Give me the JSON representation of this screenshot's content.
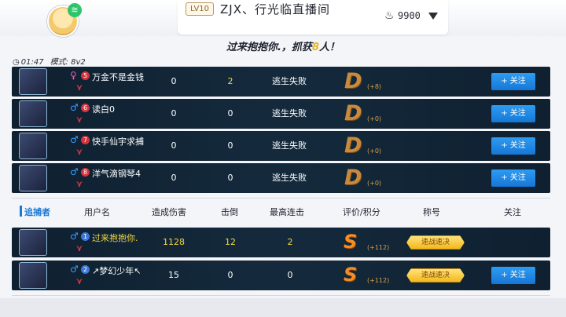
{
  "room": {
    "level": "LV10",
    "title": "ZJX、行光临直播间",
    "coins": "9900"
  },
  "headline": {
    "prefix": "过来抱抱你.，抓获",
    "count": "8",
    "suffix": "人！"
  },
  "timer": "01:47",
  "mode": "模式: 8v2",
  "survivors": [
    {
      "rank": "5",
      "gender": "♀",
      "name": "万金不是金钱",
      "damage": "0",
      "knockdowns": "2",
      "result": "逃生失败",
      "grade": "D",
      "score": "(+8)",
      "follow": "+ 关注",
      "gender_color": "#e85bb0"
    },
    {
      "rank": "6",
      "gender": "♂",
      "name": "读白0",
      "damage": "0",
      "knockdowns": "0",
      "result": "逃生失败",
      "grade": "D",
      "score": "(+0)",
      "follow": "+ 关注",
      "gender_color": "#3aa0ff"
    },
    {
      "rank": "7",
      "gender": "♂",
      "name": "快手仙宇求捕",
      "damage": "0",
      "knockdowns": "0",
      "result": "逃生失败",
      "grade": "D",
      "score": "(+0)",
      "follow": "+ 关注",
      "gender_color": "#3aa0ff"
    },
    {
      "rank": "8",
      "gender": "♂",
      "name": "洋气滴钢琴4",
      "damage": "0",
      "knockdowns": "0",
      "result": "逃生失败",
      "grade": "D",
      "score": "(+0)",
      "follow": "+ 关注",
      "gender_color": "#3aa0ff"
    }
  ],
  "headers": {
    "chaser": "追捕者",
    "username": "用户名",
    "damage": "造成伤害",
    "knockdowns": "击倒",
    "streak": "最高连击",
    "rating": "评价/积分",
    "title": "称号",
    "follow": "关注"
  },
  "chasers": [
    {
      "rank": "1",
      "gender": "♂",
      "name": "过来抱抱你.",
      "damage": "1128",
      "knockdowns": "12",
      "streak": "2",
      "grade": "S",
      "score": "(+112)",
      "title": "速战速决",
      "name_color": "#f0d840",
      "value_color": "#f0d840"
    },
    {
      "rank": "2",
      "gender": "♂",
      "name": "↗梦幻少年↖",
      "damage": "15",
      "knockdowns": "0",
      "streak": "0",
      "grade": "S",
      "score": "(+112)",
      "title": "速战速决",
      "follow": "+ 关注",
      "name_color": "#ffffff",
      "value_color": "#ffffff"
    }
  ],
  "colors": {
    "row_bg": "#142a3c",
    "accent_blue": "#1677d6",
    "highlight_yellow": "#e5b820",
    "grade_bronze": "#c98a3e",
    "grade_orange": "#f48d24"
  }
}
